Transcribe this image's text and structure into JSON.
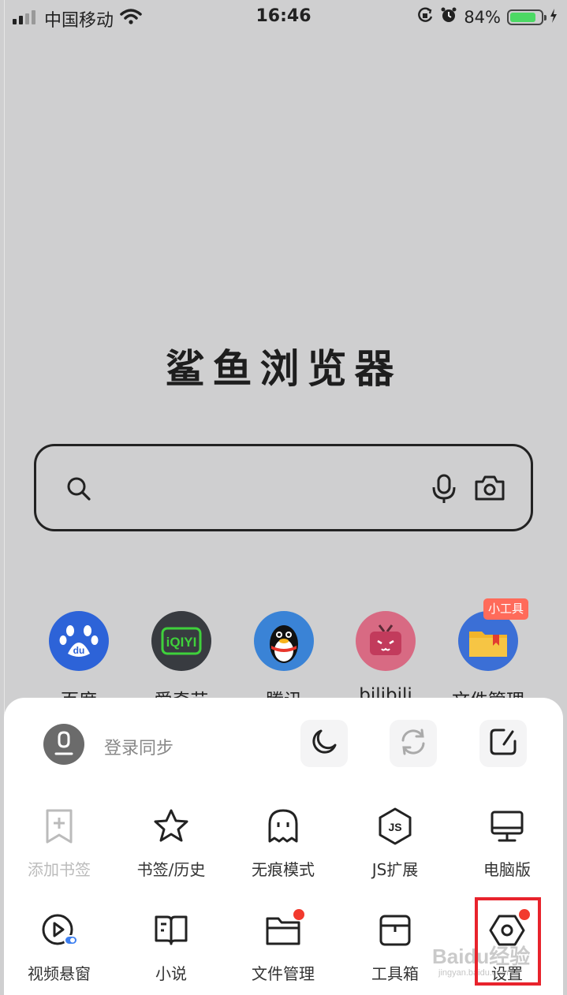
{
  "status_bar": {
    "carrier": "中国移动",
    "time": "16:46",
    "battery": "84%",
    "battery_level": 0.84,
    "icons": [
      "signal-icon",
      "wifi-icon",
      "rotation-lock-icon",
      "alarm-icon",
      "battery-icon",
      "charging-icon"
    ]
  },
  "app_title": "鲨鱼浏览器",
  "search": {
    "placeholder": "",
    "icons": [
      "search-icon",
      "microphone-icon",
      "camera-icon"
    ]
  },
  "shortcuts": [
    {
      "label": "百度",
      "icon": "baidu-icon",
      "color": "#2d63d8"
    },
    {
      "label": "爱奇艺",
      "icon": "iqiyi-icon",
      "color": "#383b40"
    },
    {
      "label": "腾讯",
      "icon": "qq-penguin-icon",
      "color": "#3a83d6"
    },
    {
      "label": "bilibili",
      "icon": "bilibili-icon",
      "color": "#d86a83"
    },
    {
      "label": "文件管理",
      "icon": "folder-icon",
      "color": "#3b6fd6"
    }
  ],
  "shortcut_badge": "小工具",
  "menu": {
    "login_label": "登录同步",
    "quick_actions": [
      "night-mode-icon",
      "refresh-icon",
      "share-icon"
    ],
    "items_row1": [
      {
        "label": "添加书签",
        "icon": "add-bookmark-icon",
        "disabled": true
      },
      {
        "label": "书签/历史",
        "icon": "star-icon"
      },
      {
        "label": "无痕模式",
        "icon": "ghost-icon"
      },
      {
        "label": "JS扩展",
        "icon": "js-icon"
      },
      {
        "label": "电脑版",
        "icon": "monitor-icon"
      }
    ],
    "items_row2": [
      {
        "label": "视频悬窗",
        "icon": "video-float-icon"
      },
      {
        "label": "小说",
        "icon": "book-icon"
      },
      {
        "label": "文件管理",
        "icon": "folder-icon",
        "badge_dot": true
      },
      {
        "label": "工具箱",
        "icon": "toolbox-icon"
      },
      {
        "label": "设置",
        "icon": "settings-icon",
        "badge_dot": true
      }
    ]
  },
  "watermark": {
    "text": "Baidu经验",
    "sub": "jingyan.baidu.com"
  },
  "colors": {
    "background": "#cfcfd0",
    "sheet": "#ffffff",
    "accent_red": "#f23a2e",
    "highlight": "#e8232c",
    "badge": "#ff6b5a"
  }
}
